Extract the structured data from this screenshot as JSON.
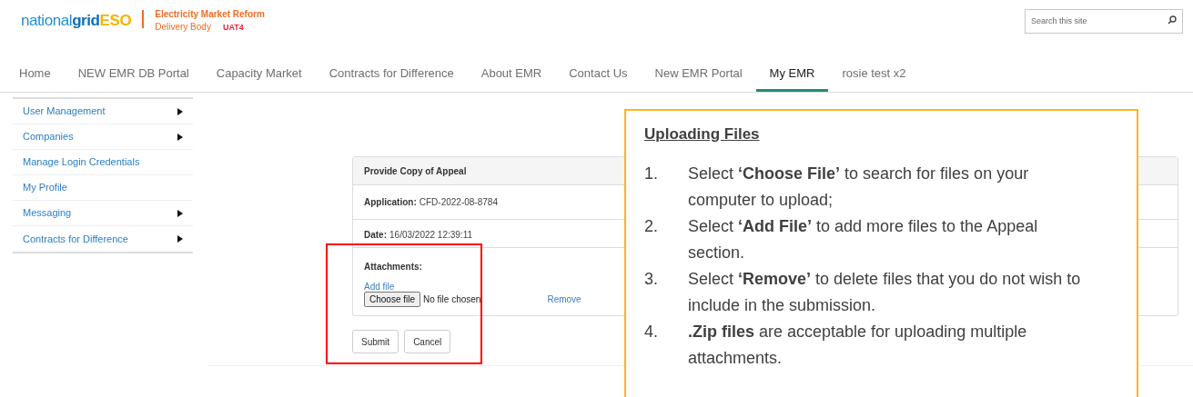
{
  "header": {
    "logo": {
      "part_1": "national",
      "part_2": "grid",
      "part_3": "ESO"
    },
    "subtitle_line_1": "Electricity Market Reform",
    "subtitle_line_2": "Delivery Body",
    "environment": "UAT4",
    "search": {
      "placeholder": "Search this site"
    }
  },
  "nav": [
    {
      "label": "Home",
      "selected": false
    },
    {
      "label": "NEW EMR DB Portal",
      "selected": false
    },
    {
      "label": "Capacity Market",
      "selected": false
    },
    {
      "label": "Contracts for Difference",
      "selected": false
    },
    {
      "label": "About EMR",
      "selected": false
    },
    {
      "label": "Contact Us",
      "selected": false
    },
    {
      "label": "New EMR Portal",
      "selected": false
    },
    {
      "label": "My EMR",
      "selected": true
    },
    {
      "label": "rosie test x2",
      "selected": false
    }
  ],
  "sidebar": [
    {
      "label": "User Management",
      "has_submenu": true
    },
    {
      "label": "Companies",
      "has_submenu": true
    },
    {
      "label": "Manage Login Credentials",
      "has_submenu": false
    },
    {
      "label": "My Profile",
      "has_submenu": false
    },
    {
      "label": "Messaging",
      "has_submenu": true
    },
    {
      "label": "Contracts for Difference",
      "has_submenu": true
    }
  ],
  "form": {
    "title": "Provide Copy of Appeal",
    "fields": [
      {
        "label": "Application:",
        "value": "CFD-2022-08-8784"
      },
      {
        "label": "Date:",
        "value": "16/03/2022 12:39:11"
      }
    ],
    "attachments": {
      "label": "Attachments:",
      "add_link": "Add file",
      "choose_button": "Choose file",
      "file_status": "No file chosen",
      "remove_link": "Remove"
    },
    "buttons": [
      "Submit",
      "Cancel"
    ]
  },
  "callout": {
    "title": "Uploading Files",
    "items": [
      {
        "number": "1.",
        "text": "Select **‘Choose File’** to search for files on your computer to upload;"
      },
      {
        "number": "2.",
        "text": "Select **‘Add File’** to add more files to the Appeal section."
      },
      {
        "number": "3.",
        "text": "Select **‘Remove’** to delete files that you do not wish to include in the submission."
      },
      {
        "number": "4.",
        "text": "**.Zip files** are acceptable for uploading multiple attachments."
      }
    ]
  }
}
